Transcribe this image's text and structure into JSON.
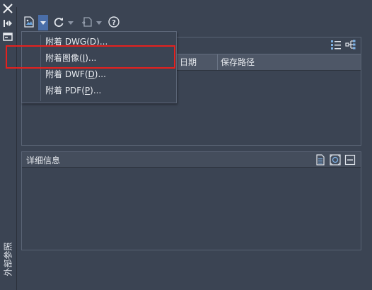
{
  "palette": {
    "title": "外部参照"
  },
  "toolbar": {
    "attach_icon": "attach-image-icon",
    "refresh_icon": "refresh-icon",
    "change_path_icon": "change-path-icon",
    "help_icon": "help-icon"
  },
  "dropdown": {
    "items": [
      {
        "prefix": "附着 DWG(",
        "key": "D",
        "suffix": ")..."
      },
      {
        "prefix": "附着图像(",
        "key": "I",
        "suffix": ")..."
      },
      {
        "prefix": "附着 DWF(",
        "key": "D",
        "suffix": ")..."
      },
      {
        "prefix": "附着 PDF(",
        "key": "P",
        "suffix": ")..."
      }
    ]
  },
  "refs": {
    "columns": {
      "date": "日期",
      "saved_path": "保存路径"
    }
  },
  "details": {
    "title": "详细信息"
  },
  "colors": {
    "background": "#3b4453",
    "menu_accent": "#4a6ea8",
    "highlight": "#e5211e"
  }
}
